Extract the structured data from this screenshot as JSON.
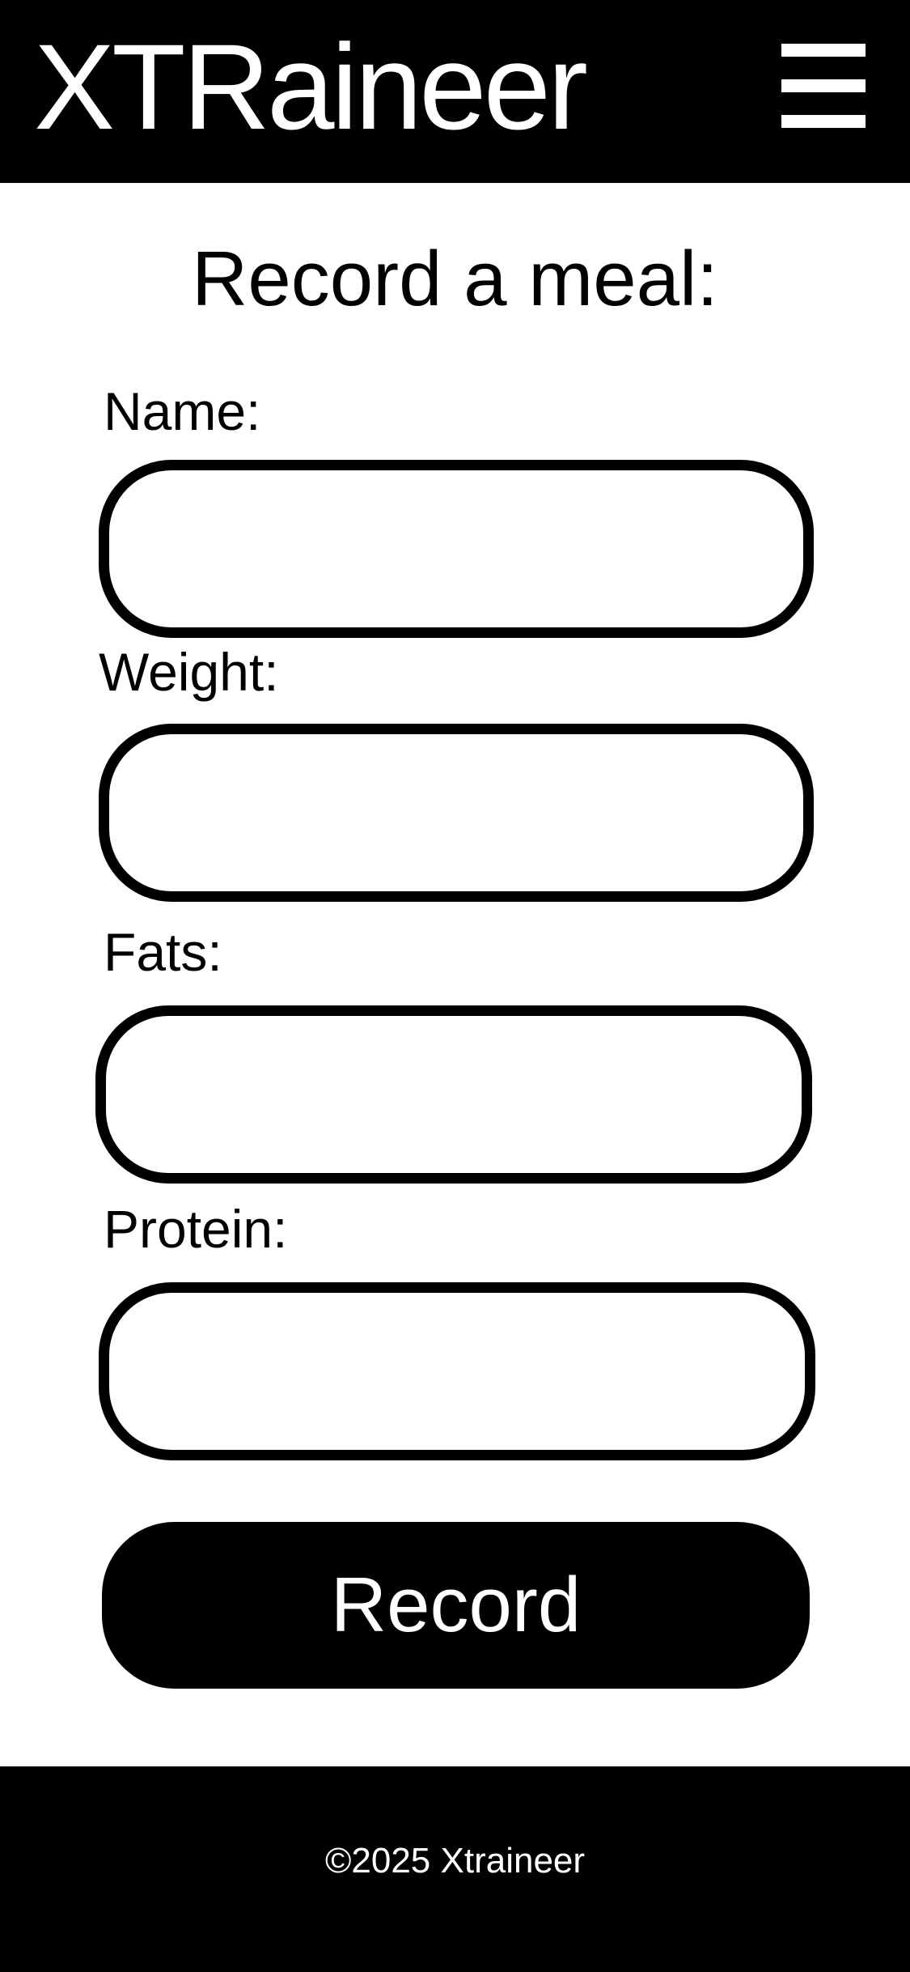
{
  "header": {
    "brand": "XTRaineer",
    "menu_icon": "hamburger-menu-icon"
  },
  "form": {
    "title": "Record a meal:",
    "fields": [
      {
        "label": "Name:",
        "value": "",
        "placeholder": ""
      },
      {
        "label": "Weight:",
        "value": "",
        "placeholder": ""
      },
      {
        "label": "Fats:",
        "value": "",
        "placeholder": ""
      },
      {
        "label": "Protein:",
        "value": "",
        "placeholder": ""
      }
    ],
    "submit_label": "Record"
  },
  "footer": {
    "copyright": "©2025 Xtraineer"
  },
  "colors": {
    "background": "#ffffff",
    "primary": "#000000",
    "on_primary": "#ffffff"
  }
}
